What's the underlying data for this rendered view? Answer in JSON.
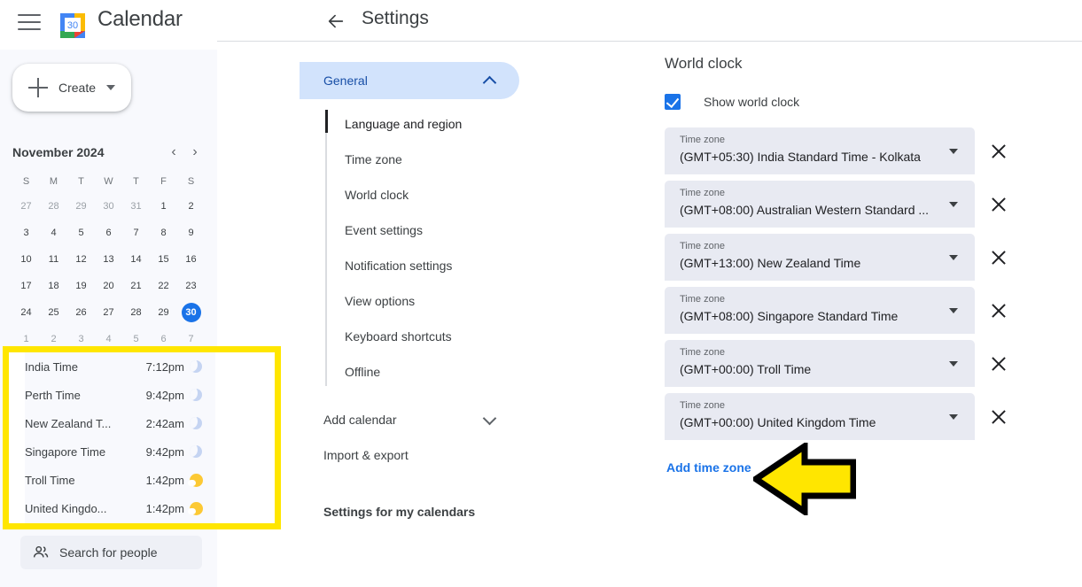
{
  "app": {
    "brand": "Calendar",
    "logo_day": "30",
    "menu_icon": "hamburger-icon"
  },
  "create": {
    "label": "Create"
  },
  "mini_calendar": {
    "title": "November 2024",
    "prev_label": "‹",
    "next_label": "›",
    "day_headers": [
      "S",
      "M",
      "T",
      "W",
      "T",
      "F",
      "S"
    ],
    "weeks": [
      [
        {
          "d": "27",
          "muted": true
        },
        {
          "d": "28",
          "muted": true
        },
        {
          "d": "29",
          "muted": true
        },
        {
          "d": "30",
          "muted": true
        },
        {
          "d": "31",
          "muted": true
        },
        {
          "d": "1",
          "muted": false
        },
        {
          "d": "2",
          "muted": false
        }
      ],
      [
        {
          "d": "3",
          "muted": false
        },
        {
          "d": "4",
          "muted": false
        },
        {
          "d": "5",
          "muted": false
        },
        {
          "d": "6",
          "muted": false
        },
        {
          "d": "7",
          "muted": false
        },
        {
          "d": "8",
          "muted": false
        },
        {
          "d": "9",
          "muted": false
        }
      ],
      [
        {
          "d": "10",
          "muted": false
        },
        {
          "d": "11",
          "muted": false
        },
        {
          "d": "12",
          "muted": false
        },
        {
          "d": "13",
          "muted": false
        },
        {
          "d": "14",
          "muted": false
        },
        {
          "d": "15",
          "muted": false
        },
        {
          "d": "16",
          "muted": false
        }
      ],
      [
        {
          "d": "17",
          "muted": false
        },
        {
          "d": "18",
          "muted": false
        },
        {
          "d": "19",
          "muted": false
        },
        {
          "d": "20",
          "muted": false
        },
        {
          "d": "21",
          "muted": false
        },
        {
          "d": "22",
          "muted": false
        },
        {
          "d": "23",
          "muted": false
        }
      ],
      [
        {
          "d": "24",
          "muted": false
        },
        {
          "d": "25",
          "muted": false
        },
        {
          "d": "26",
          "muted": false
        },
        {
          "d": "27",
          "muted": false
        },
        {
          "d": "28",
          "muted": false
        },
        {
          "d": "29",
          "muted": false
        },
        {
          "d": "30",
          "muted": false,
          "today": true
        }
      ],
      [
        {
          "d": "1",
          "muted": true
        },
        {
          "d": "2",
          "muted": true
        },
        {
          "d": "3",
          "muted": true
        },
        {
          "d": "4",
          "muted": true
        },
        {
          "d": "5",
          "muted": true
        },
        {
          "d": "6",
          "muted": true
        },
        {
          "d": "7",
          "muted": true
        }
      ]
    ]
  },
  "world_clock_panel": {
    "highlight_color": "#ffe600",
    "rows": [
      {
        "name": "India Time",
        "time": "7:12pm",
        "icon": "moon-icon"
      },
      {
        "name": "Perth Time",
        "time": "9:42pm",
        "icon": "moon-icon"
      },
      {
        "name": "New Zealand T...",
        "time": "2:42am",
        "icon": "moon-icon"
      },
      {
        "name": "Singapore Time",
        "time": "9:42pm",
        "icon": "moon-icon"
      },
      {
        "name": "Troll Time",
        "time": "1:42pm",
        "icon": "sun-icon"
      },
      {
        "name": "United Kingdo...",
        "time": "1:42pm",
        "icon": "sun-icon"
      }
    ]
  },
  "search_people": {
    "label": "Search for people",
    "icon": "people-icon"
  },
  "settings_header": {
    "title": "Settings",
    "back_icon": "back-arrow-icon"
  },
  "settings_nav": {
    "general": {
      "label": "General",
      "expanded": true,
      "chevron": "chevron-up-icon"
    },
    "sub_items": [
      {
        "label": "Language and region",
        "active": true
      },
      {
        "label": "Time zone",
        "active": false
      },
      {
        "label": "World clock",
        "active": false
      },
      {
        "label": "Event settings",
        "active": false
      },
      {
        "label": "Notification settings",
        "active": false
      },
      {
        "label": "View options",
        "active": false
      },
      {
        "label": "Keyboard shortcuts",
        "active": false
      },
      {
        "label": "Offline",
        "active": false
      }
    ],
    "add_calendar": {
      "label": "Add calendar",
      "chevron": "chevron-down-icon"
    },
    "import_export": {
      "label": "Import & export"
    },
    "my_calendars": {
      "label": "Settings for my calendars"
    }
  },
  "main": {
    "heading": "World clock",
    "show_world_clock": {
      "label": "Show world clock",
      "checked": true,
      "accent": "#1a73e8"
    },
    "timezone_caption": "Time zone",
    "timezones": [
      {
        "value": "(GMT+05:30) India Standard Time - Kolkata"
      },
      {
        "value": "(GMT+08:00) Australian Western Standard ..."
      },
      {
        "value": "(GMT+13:00) New Zealand Time"
      },
      {
        "value": "(GMT+08:00) Singapore Standard Time"
      },
      {
        "value": "(GMT+00:00) Troll Time"
      },
      {
        "value": "(GMT+00:00) United Kingdom Time"
      }
    ],
    "add_time_zone": {
      "label": "Add time zone",
      "color": "#1a73e8"
    }
  },
  "annotation": {
    "arrow_fill": "#ffe600",
    "arrow_stroke": "#000000",
    "arrow_direction": "left"
  }
}
